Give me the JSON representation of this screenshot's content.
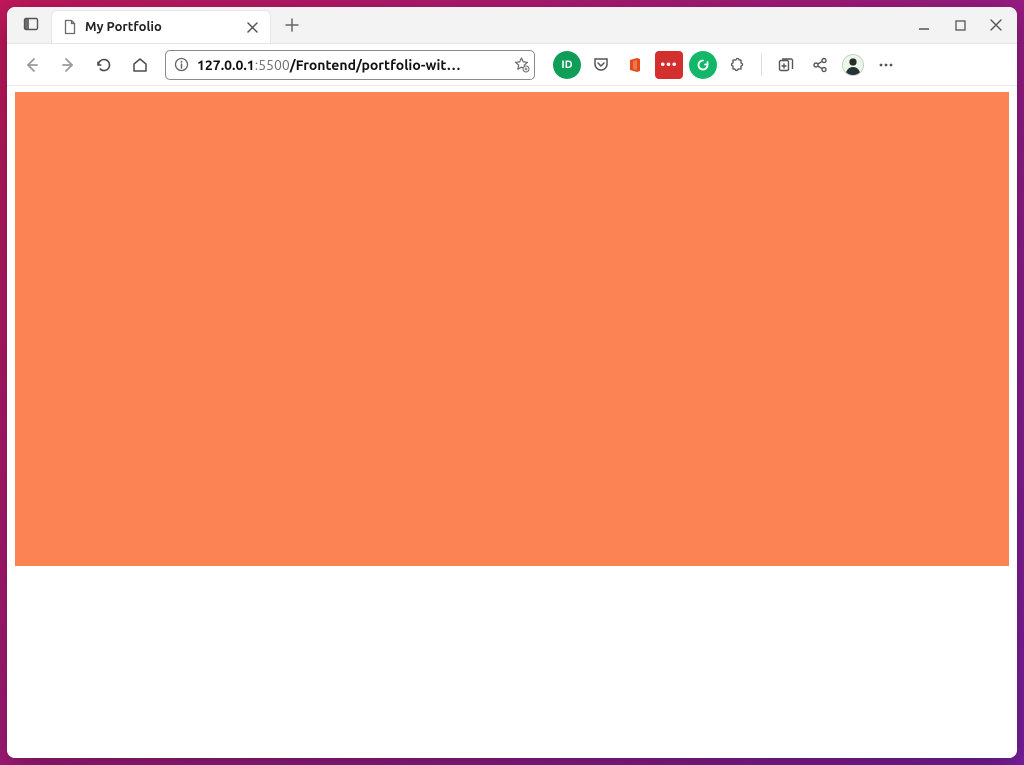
{
  "tab": {
    "title": "My Portfolio"
  },
  "address": {
    "host": "127.0.0.1",
    "port": ":5500",
    "path": "/Frontend/portfolio-wit…"
  },
  "extensions": {
    "adblocker_glyph": "ID",
    "lastpass_glyph": "•••"
  },
  "page": {
    "hero_color": "#fc8353"
  }
}
